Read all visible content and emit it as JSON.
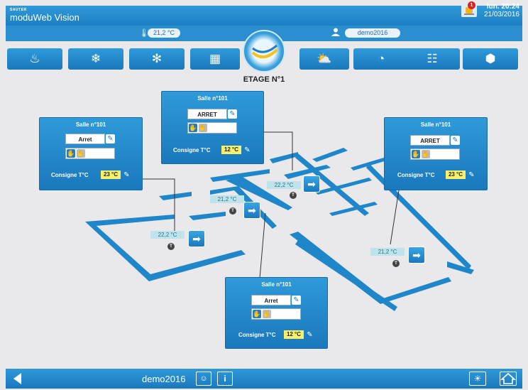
{
  "header": {
    "brand_small": "SAUTER",
    "brand_main": "moduWeb Vision",
    "alarm_count": "1",
    "time": "lun. 20:24",
    "date": "21/03/2016"
  },
  "subbar": {
    "outdoor_temp": "21,2 °C",
    "user": "demo2016"
  },
  "nav": {
    "items": [
      "heating",
      "cooling",
      "ventilation",
      "building",
      "home-logo",
      "weather",
      "meter",
      "network",
      "objects"
    ]
  },
  "page_title": "ETAGE N°1",
  "rooms": [
    {
      "title": "Salle n°101",
      "mode": "Arret",
      "consigne_label": "Consigne T°C",
      "consigne": "23 °C",
      "temp": "22,2 °C"
    },
    {
      "title": "Salle n°101",
      "mode": "ARRET",
      "consigne_label": "Consigne T°C",
      "consigne": "12 °C",
      "temp": "22,2 °C"
    },
    {
      "title": "Salle n°101",
      "mode": "ARRET",
      "consigne_label": "Consigne T°C",
      "consigne": "23 °C",
      "temp": "21,2 °C"
    },
    {
      "title": "Salle n°101",
      "mode": "Arret",
      "consigne_label": "Consigne T°C",
      "consigne": "12 °C",
      "temp": "21,2 °C"
    }
  ],
  "extra_temp": "21,2 °C",
  "footer": {
    "user": "demo2016"
  },
  "colors": {
    "accent": "#1f7fc4",
    "setpoint_bg": "#f7f06a",
    "temp_bg": "#bfe3ea"
  }
}
